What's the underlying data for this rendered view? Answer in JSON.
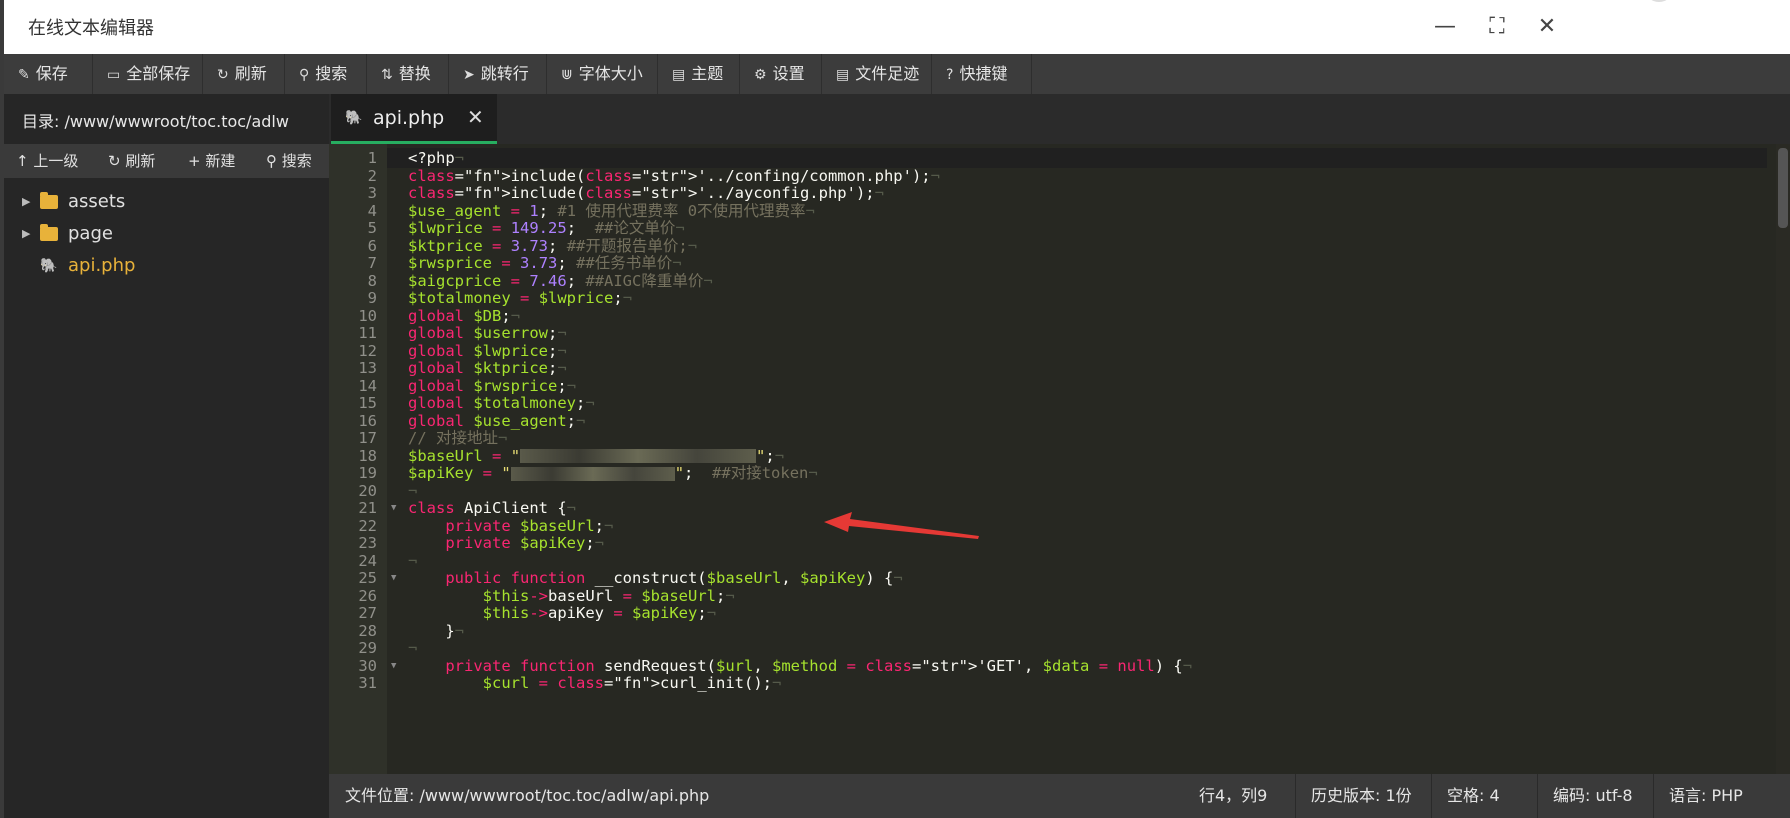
{
  "window": {
    "title": "在线文本编辑器",
    "controls": {
      "minimize": "—",
      "maximize": "⛶",
      "close": "✕"
    }
  },
  "toolbar": {
    "items": [
      {
        "icon": "save-icon",
        "glyph": "✎",
        "label": "保存"
      },
      {
        "icon": "save-all-icon",
        "glyph": "▭",
        "label": "全部保存"
      },
      {
        "icon": "refresh-icon",
        "glyph": "↻",
        "label": "刷新"
      },
      {
        "icon": "search-icon",
        "glyph": "⚲",
        "label": "搜索"
      },
      {
        "icon": "replace-icon",
        "glyph": "⇅",
        "label": "替换"
      },
      {
        "icon": "goto-line-icon",
        "glyph": "➤",
        "label": "跳转行"
      },
      {
        "icon": "font-size-icon",
        "glyph": "⋓",
        "label": "字体大小"
      },
      {
        "icon": "theme-icon",
        "glyph": "▤",
        "label": "主题"
      },
      {
        "icon": "settings-icon",
        "glyph": "⚙",
        "label": "设置"
      },
      {
        "icon": "file-history-icon",
        "glyph": "▤",
        "label": "文件足迹"
      },
      {
        "icon": "help-icon",
        "glyph": "?",
        "label": "快捷键"
      }
    ]
  },
  "sidebar": {
    "directory_label": "目录: /www/wwwroot/toc.toc/adlw",
    "tools": [
      {
        "glyph": "↑",
        "label": "上一级"
      },
      {
        "glyph": "↻",
        "label": "刷新"
      },
      {
        "glyph": "+",
        "label": "新建"
      },
      {
        "glyph": "⚲",
        "label": "搜索"
      }
    ],
    "tree": [
      {
        "type": "folder",
        "name": "assets"
      },
      {
        "type": "folder",
        "name": "page"
      },
      {
        "type": "file",
        "name": "api.php",
        "active_color": "#e8b23a"
      }
    ]
  },
  "tabs": [
    {
      "name": "api.php",
      "close": "✕",
      "active": true
    }
  ],
  "code": {
    "line_numbers": [
      "1",
      "2",
      "3",
      "4",
      "5",
      "6",
      "7",
      "8",
      "9",
      "10",
      "11",
      "12",
      "13",
      "14",
      "15",
      "16",
      "17",
      "18",
      "19",
      "20",
      "21",
      "22",
      "23",
      "24",
      "25",
      "26",
      "27",
      "28",
      "29",
      "30",
      "31"
    ],
    "lines": [
      "<?php",
      "include('../confing/common.php');",
      "include('../ayconfig.php');",
      "$use_agent = 1; #1 使用代理费率 0不使用代理费率",
      "$lwprice = 149.25;  ##论文单价",
      "$ktprice = 3.73; ##开题报告单价;",
      "$rwsprice = 3.73; ##任务书单价",
      "$aigcprice = 7.46; ##AIGC降重单价",
      "$totalmoney = $lwprice;",
      "global $DB;",
      "global $userrow;",
      "global $lwprice;",
      "global $ktprice;",
      "global $rwsprice;",
      "global $totalmoney;",
      "global $use_agent;",
      "// 对接地址",
      "$baseUrl = \"\";",
      "$apiKey = \"\";  ##对接token",
      "",
      "class ApiClient {",
      "    private $baseUrl;",
      "    private $apiKey;",
      "",
      "    public function __construct($baseUrl, $apiKey) {",
      "        $this->baseUrl = $baseUrl;",
      "        $this->apiKey = $apiKey;",
      "    }",
      "",
      "    private function sendRequest($url, $method = 'GET', $data = null) {",
      "        $curl = curl_init();"
    ]
  },
  "statusbar": {
    "file_path": "文件位置: /www/wwwroot/toc.toc/adlw/api.php",
    "cursor": "行4，列9",
    "history": "历史版本: 1份",
    "indent": "空格: 4",
    "encoding": "编码: utf-8",
    "language": "语言: PHP"
  },
  "colors": {
    "accent_tab": "#27ae60",
    "keyword": "#f92672",
    "string": "#e6db74",
    "number": "#ae81ff",
    "variable": "#a6e22e",
    "function": "#66d9ef",
    "comment": "#75715e",
    "annotation_arrow": "#e53935"
  }
}
